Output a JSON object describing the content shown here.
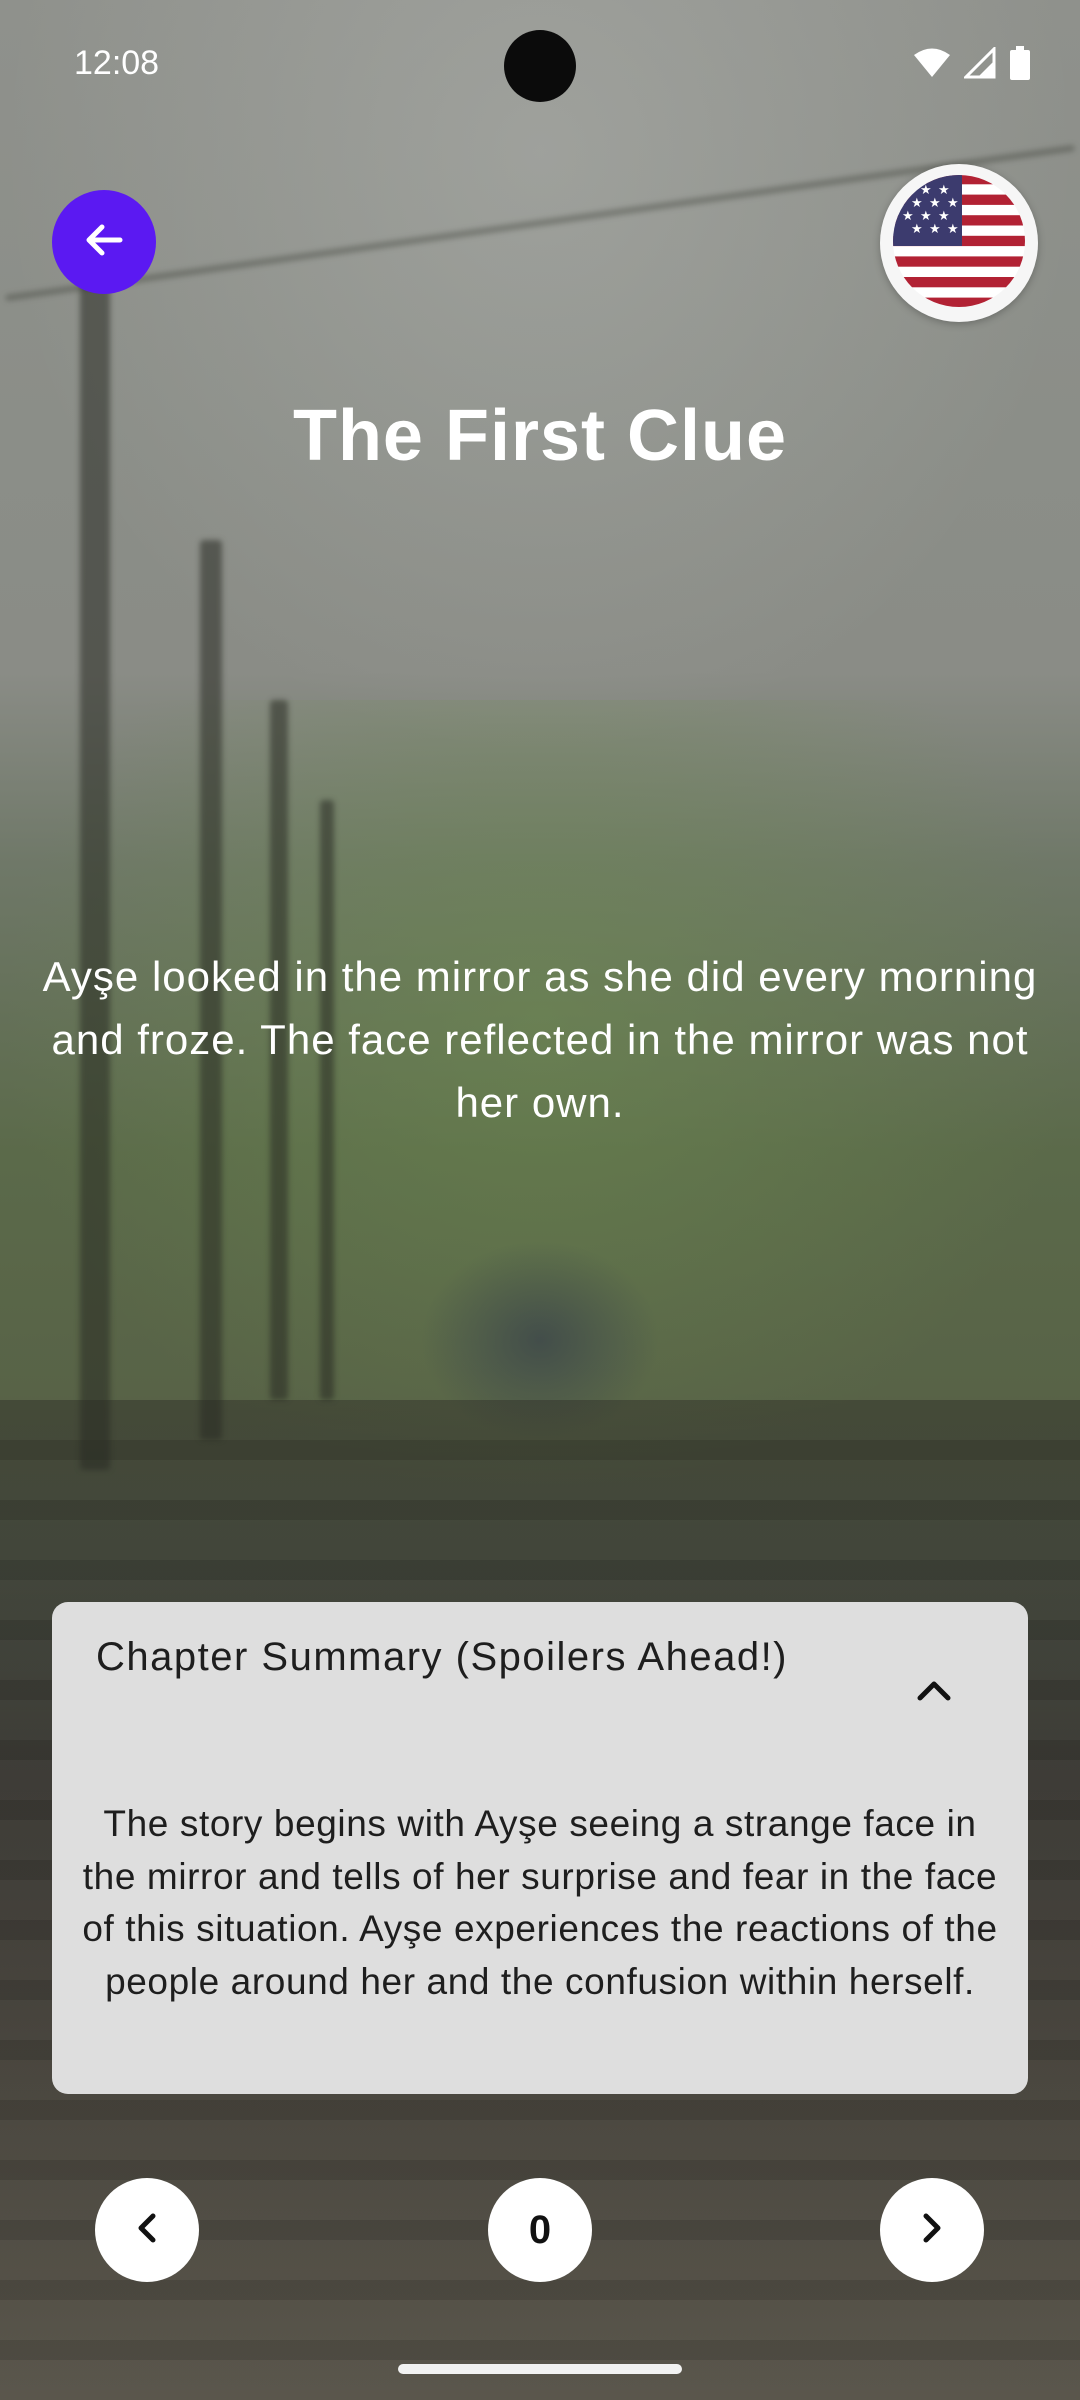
{
  "status_bar": {
    "time": "12:08",
    "icons": [
      "wifi-icon",
      "signal-icon",
      "battery-icon"
    ]
  },
  "header": {
    "back_icon": "arrow-left-icon",
    "language_flag": "us-flag-icon"
  },
  "chapter": {
    "title": "The First Clue",
    "text": "Ayşe looked in the mirror as she did every morning and froze. The face reflected in the mirror was not her own."
  },
  "summary": {
    "header": "Chapter Summary (Spoilers Ahead!)",
    "toggle_icon": "chevron-up-icon",
    "body": "The story begins with Ayşe seeing a strange face in the mirror and tells of her surprise and fear in the face of this situation. Ayşe experiences the reactions of the people around her and the confusion within herself."
  },
  "navigation": {
    "prev_icon": "chevron-left-icon",
    "counter": "0",
    "next_icon": "chevron-right-icon"
  },
  "colors": {
    "accent": "#5b19f2",
    "card_background": "#dedede"
  }
}
